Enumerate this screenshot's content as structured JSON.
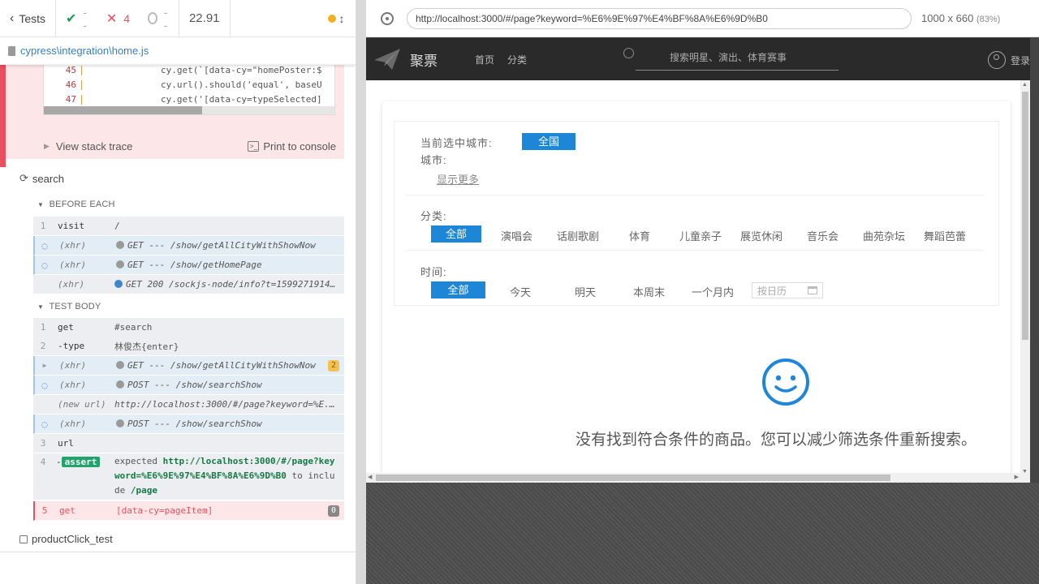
{
  "reporter": {
    "tests_label": "Tests",
    "passed": "--",
    "failed": "4",
    "pending": "--",
    "duration": "22.91",
    "spec_file": "cypress\\integration\\home.js",
    "error_code": [
      {
        "line": "45",
        "code": "cy.get(`[data-cy=\"homePoster:$"
      },
      {
        "line": "46",
        "code": "cy.url().should('equal', baseU"
      },
      {
        "line": "47",
        "code": "cy.get('[data-cy=typeSelected]"
      }
    ],
    "view_stack_trace": "View stack trace",
    "print_to_console": "Print to console",
    "suite_name": "search",
    "before_each_label": "BEFORE EACH",
    "before_each": [
      {
        "num": "1",
        "name": "visit",
        "msg": "/",
        "kind": "cmd"
      },
      {
        "num": "",
        "name": "(xhr)",
        "msg": "GET --- /show/getAllCityWithShowNow",
        "kind": "xhr",
        "dot": "grey"
      },
      {
        "num": "",
        "name": "(xhr)",
        "msg": "GET --- /show/getHomePage",
        "kind": "xhr",
        "dot": "grey"
      },
      {
        "num": "",
        "name": "(xhr)",
        "msg": "GET 200 /sockjs-node/info?t=1599271914...",
        "kind": "plain",
        "dot": "blue"
      }
    ],
    "test_body_label": "TEST BODY",
    "test_body": {
      "r1": {
        "num": "1",
        "name": "get",
        "msg": "#search"
      },
      "r2": {
        "num": "2",
        "name": "-type",
        "msg": "林俊杰{enter}"
      },
      "r3": {
        "name": "(xhr)",
        "msg": "GET --- /show/getAllCityWithShowNow",
        "badge": "2"
      },
      "r4": {
        "name": "(xhr)",
        "msg": "POST --- /show/searchShow"
      },
      "r5": {
        "name": "(new url)",
        "msg": "http://localhost:3000/#/page?keyword=%E..."
      },
      "r6": {
        "name": "(xhr)",
        "msg": "POST --- /show/searchShow"
      },
      "r7": {
        "num": "3",
        "name": "url"
      },
      "r8": {
        "num": "4",
        "dash": "-",
        "assert": "assert",
        "expected": "expected",
        "url": "http://localhost:3000/#/page?keyword=%E6%9E%97%E4%BF%8A%E6%9D%B0",
        "to_include": "to include",
        "path": "/page"
      },
      "r9": {
        "num": "5",
        "name": "get",
        "msg": "[data-cy=pageItem]",
        "badge": "0"
      }
    },
    "next_test": "productClick_test"
  },
  "aut": {
    "url": "http://localhost:3000/#/page?keyword=%E6%9E%97%E4%BF%8A%E6%9D%B0",
    "viewport": "1000 x 660",
    "scale": "(83%)",
    "site": {
      "logo_text": "聚票",
      "nav": [
        "首页",
        "分类"
      ],
      "search_placeholder": "搜索明星、演出、体育赛事",
      "login": "登录",
      "current_city_label": "当前选中城市:",
      "current_city": "全国",
      "city_label": "城市:",
      "show_more": "显示更多",
      "category_label": "分类:",
      "categories": [
        "全部",
        "演唱会",
        "话剧歌剧",
        "体育",
        "儿童亲子",
        "展览休闲",
        "音乐会",
        "曲苑杂坛",
        "舞蹈芭蕾"
      ],
      "time_label": "时间:",
      "times": [
        "全部",
        "今天",
        "明天",
        "本周末",
        "一个月内"
      ],
      "date_placeholder": "按日历",
      "empty_message": "没有找到符合条件的商品。您可以减少筛选条件重新搜索。"
    }
  },
  "colors": {
    "accent": "#1e86d6",
    "fail": "#e94f5f",
    "pass": "#1f9a5a"
  }
}
